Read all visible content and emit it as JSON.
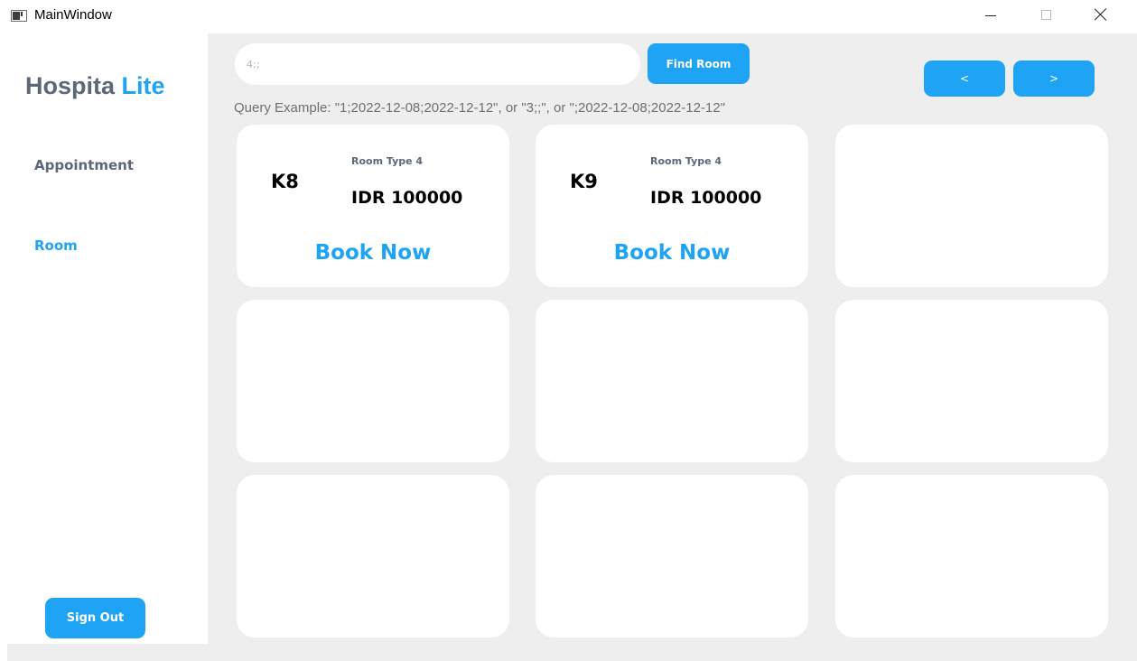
{
  "window": {
    "title": "MainWindow"
  },
  "sidebar": {
    "logo_part1": "Hospita",
    "logo_part2": "Lite",
    "items": [
      {
        "label": "Appointment",
        "active": false
      },
      {
        "label": "Room",
        "active": true
      }
    ],
    "signout_label": "Sign Out"
  },
  "search": {
    "value": "4;;",
    "button_label": "Find Room",
    "hint": "Query Example: \"1;2022-12-08;2022-12-12\", or \"3;;\", or \";2022-12-08;2022-12-12\""
  },
  "pager": {
    "prev_label": "<",
    "next_label": ">"
  },
  "rooms": [
    {
      "code": "K8",
      "type": "Room Type 4",
      "price": "IDR 100000",
      "action": "Book Now"
    },
    {
      "code": "K9",
      "type": "Room Type 4",
      "price": "IDR 100000",
      "action": "Book Now"
    }
  ],
  "colors": {
    "accent": "#1fa3f4",
    "muted": "#5d6778",
    "background": "#eeeeee"
  }
}
